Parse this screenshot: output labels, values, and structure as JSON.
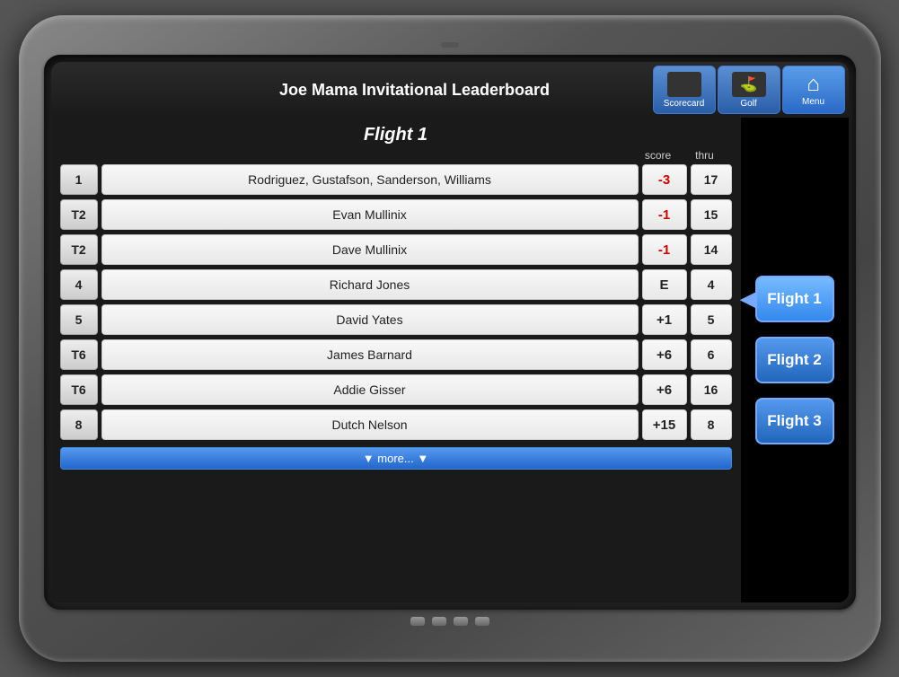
{
  "device": {
    "camera": "camera"
  },
  "header": {
    "title": "Joe Mama Invitational Leaderboard",
    "scorecard_label": "Scorecard",
    "golf_label": "Golf",
    "menu_label": "Menu"
  },
  "leaderboard": {
    "flight_title": "Flight 1",
    "col_score": "score",
    "col_thru": "thru",
    "rows": [
      {
        "rank": "1",
        "name": "Rodriguez, Gustafson, Sanderson, Williams",
        "score": "-3",
        "thru": "17",
        "score_class": "negative"
      },
      {
        "rank": "T2",
        "name": "Evan Mullinix",
        "score": "-1",
        "thru": "15",
        "score_class": "negative"
      },
      {
        "rank": "T2",
        "name": "Dave Mullinix",
        "score": "-1",
        "thru": "14",
        "score_class": "negative"
      },
      {
        "rank": "4",
        "name": "Richard Jones",
        "score": "E",
        "thru": "4",
        "score_class": "even"
      },
      {
        "rank": "5",
        "name": "David Yates",
        "score": "+1",
        "thru": "5",
        "score_class": "positive"
      },
      {
        "rank": "T6",
        "name": "James Barnard",
        "score": "+6",
        "thru": "6",
        "score_class": "positive"
      },
      {
        "rank": "T6",
        "name": "Addie Gisser",
        "score": "+6",
        "thru": "16",
        "score_class": "positive"
      },
      {
        "rank": "8",
        "name": "Dutch Nelson",
        "score": "+15",
        "thru": "8",
        "score_class": "positive"
      }
    ],
    "more_label": "▼  more...  ▼"
  },
  "sidebar": {
    "flight1_label": "Flight 1",
    "flight2_label": "Flight 2",
    "flight3_label": "Flight 3"
  },
  "bottom_indicators": [
    1,
    2,
    3,
    4
  ]
}
